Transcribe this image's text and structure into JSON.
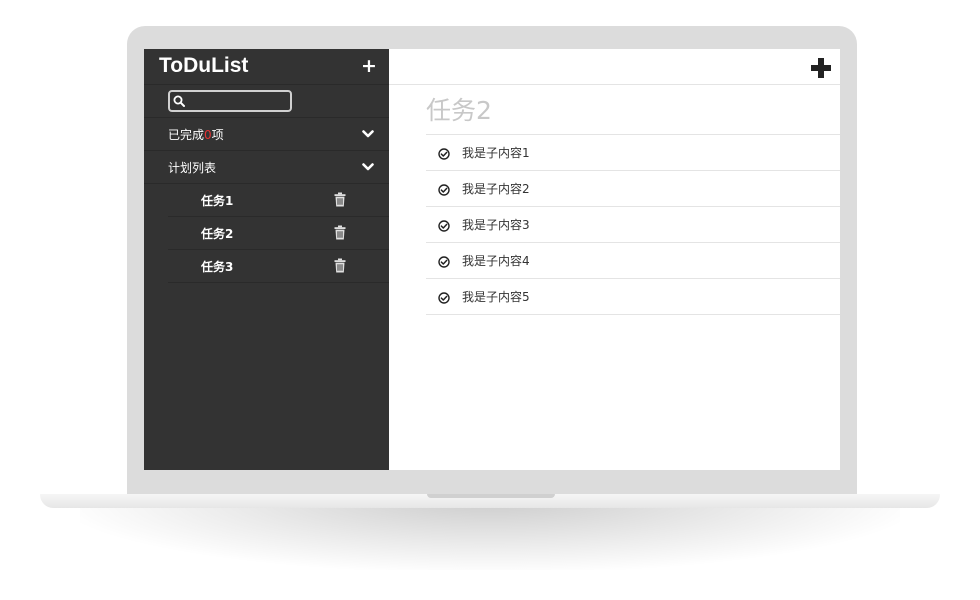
{
  "sidebar": {
    "app_title": "ToDuList",
    "add_label": "+",
    "search": {
      "value": "",
      "placeholder": ""
    },
    "completed": {
      "prefix": "已完成",
      "count": "0",
      "suffix": "项"
    },
    "plan_list_label": "计划列表",
    "tasks": [
      {
        "label": "任务1"
      },
      {
        "label": "任务2"
      },
      {
        "label": "任务3"
      }
    ]
  },
  "main": {
    "title": "任务2",
    "items": [
      {
        "label": "我是子内容1"
      },
      {
        "label": "我是子内容2"
      },
      {
        "label": "我是子内容3"
      },
      {
        "label": "我是子内容4"
      },
      {
        "label": "我是子内容5"
      }
    ]
  },
  "colors": {
    "sidebar_bg": "#333333",
    "count_accent": "#e53333",
    "title_gray": "#c8c8c8"
  },
  "icons": {
    "search": "search-icon",
    "chevron": "chevron-down-icon",
    "delete": "trash-icon",
    "item_check": "check-circle-icon",
    "add_item": "plus-icon"
  }
}
